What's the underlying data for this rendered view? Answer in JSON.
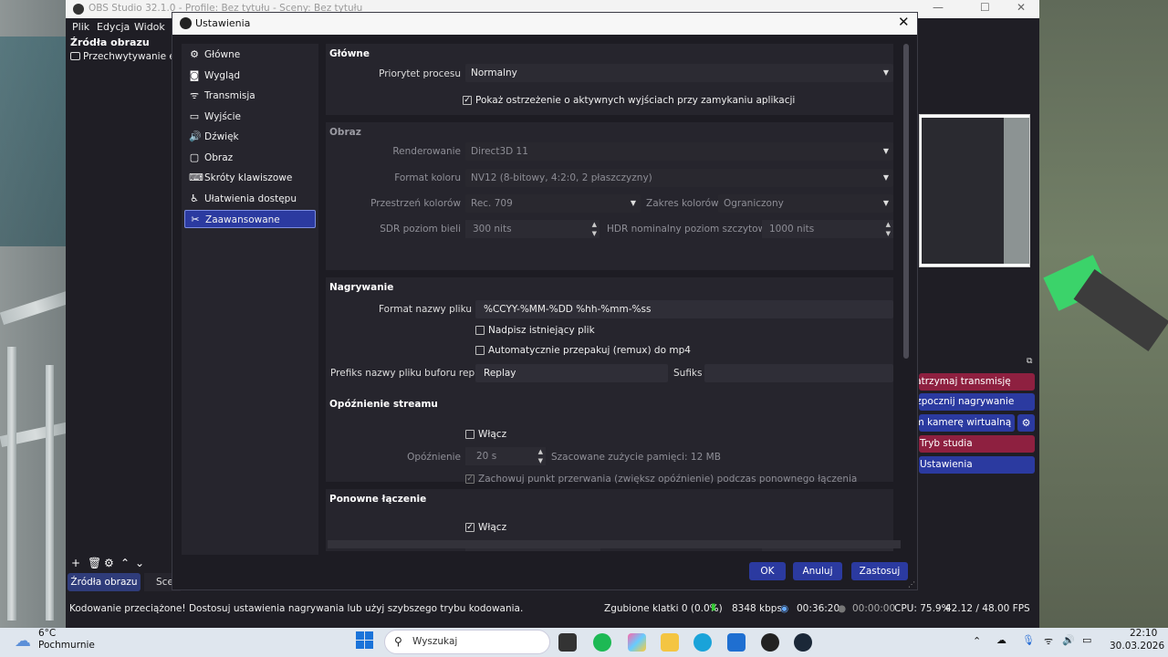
{
  "main_window": {
    "title": "OBS Studio 32.1.0 - Profile: Bez tytułu - Sceny: Bez tytułu",
    "menu": [
      "Plik",
      "Edycja",
      "Widok"
    ],
    "sources_header": "Źródła obrazu",
    "source_item": "Przechwytywanie ekranu",
    "sources_tab": "Źródła obrazu",
    "scenes_tab": "Sceny",
    "controls": {
      "stop_stream": "Zatrzymaj transmisję",
      "start_recording": "Rozpocznij nagrywanie",
      "virtual_camera": "Uruchom kamerę wirtualną",
      "studio_mode": "Tryb studia",
      "settings": "Ustawienia"
    },
    "status": {
      "warning": "Kodowanie przeciążone! Dostosuj ustawienia nagrywania lub użyj szybszego trybu kodowania.",
      "dropped": "Zgubione klatki 0 (0.0%)",
      "bitrate": "8348 kbps",
      "stream_time": "00:36:20",
      "rec_time": "00:00:00",
      "cpu": "CPU: 75.9%",
      "fps": "42.12 / 48.00 FPS"
    }
  },
  "dialog": {
    "title": "Ustawienia",
    "nav": [
      {
        "label": "Główne",
        "icon": "gear-icon"
      },
      {
        "label": "Wygląd",
        "icon": "appearance-icon"
      },
      {
        "label": "Transmisja",
        "icon": "broadcast-icon"
      },
      {
        "label": "Wyjście",
        "icon": "output-icon"
      },
      {
        "label": "Dźwięk",
        "icon": "speaker-icon"
      },
      {
        "label": "Obraz",
        "icon": "monitor-icon"
      },
      {
        "label": "Skróty klawiszowe",
        "icon": "keyboard-icon"
      },
      {
        "label": "Ułatwienia dostępu",
        "icon": "accessibility-icon"
      },
      {
        "label": "Zaawansowane",
        "icon": "wrench-icon"
      }
    ],
    "selected_nav": "Zaawansowane",
    "general": {
      "title": "Główne",
      "priority_label": "Priorytet procesu",
      "priority_value": "Normalny",
      "warn_exit": "Pokaż ostrzeżenie o aktywnych wyjściach przy zamykaniu aplikacji",
      "warn_exit_checked": true
    },
    "video": {
      "title": "Obraz",
      "renderer_label": "Renderowanie",
      "renderer_value": "Direct3D 11",
      "color_format_label": "Format koloru",
      "color_format_value": "NV12 (8-bitowy, 4:2:0, 2 płaszczyzny)",
      "color_space_label": "Przestrzeń kolorów",
      "color_space_value": "Rec. 709",
      "color_range_label": "Zakres kolorów",
      "color_range_value": "Ograniczony",
      "sdr_label": "SDR poziom bieli",
      "sdr_value": "300 nits",
      "hdr_label": "HDR nominalny poziom szczytowy",
      "hdr_value": "1000 nits"
    },
    "recording": {
      "title": "Nagrywanie",
      "filename_label": "Format nazwy pliku",
      "filename_value": "%CCYY-%MM-%DD %hh-%mm-%ss",
      "overwrite": "Nadpisz istniejący plik",
      "remux": "Automatycznie przepakuj (remux) do mp4",
      "prefix_label": "Prefiks nazwy pliku buforu replay",
      "prefix_value": "Replay",
      "suffix_label": "Sufiks",
      "suffix_value": ""
    },
    "stream_delay": {
      "title": "Opóźnienie streamu",
      "enable": "Włącz",
      "delay_label": "Opóźnienie",
      "delay_value": "20 s",
      "memory": "Szacowane zużycie pamięci: 12 MB",
      "preserve": "Zachowuj punkt przerwania (zwiększ opóźnienie) podczas ponownego łączenia"
    },
    "reconnect": {
      "title": "Ponowne łączenie",
      "enable": "Włącz",
      "enable_checked": true
    },
    "buttons": {
      "ok": "OK",
      "cancel": "Anuluj",
      "apply": "Zastosuj"
    }
  },
  "taskbar": {
    "weather_temp": "6°C",
    "weather_desc": "Pochmurnie",
    "search_placeholder": "Wyszukaj",
    "time": "22:10",
    "date": "30.03.2026"
  }
}
